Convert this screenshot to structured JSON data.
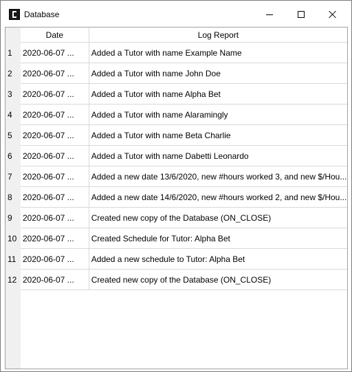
{
  "window": {
    "title": "Database",
    "icon": "app-logo-icon"
  },
  "table": {
    "headers": {
      "date": "Date",
      "log": "Log Report"
    },
    "rows": [
      {
        "num": "1",
        "date": "2020-06-07 ...",
        "log": "Added a Tutor with name Example Name"
      },
      {
        "num": "2",
        "date": "2020-06-07 ...",
        "log": "Added a Tutor with name John Doe"
      },
      {
        "num": "3",
        "date": "2020-06-07 ...",
        "log": "Added a Tutor with name Alpha Bet"
      },
      {
        "num": "4",
        "date": "2020-06-07 ...",
        "log": "Added a Tutor with name Alaramingly"
      },
      {
        "num": "5",
        "date": "2020-06-07 ...",
        "log": "Added a Tutor with name Beta Charlie"
      },
      {
        "num": "6",
        "date": "2020-06-07 ...",
        "log": "Added a Tutor with name Dabetti Leonardo"
      },
      {
        "num": "7",
        "date": "2020-06-07 ...",
        "log": "Added a new date 13/6/2020, new #hours worked 3, and new $/Hou..."
      },
      {
        "num": "8",
        "date": "2020-06-07 ...",
        "log": "Added a new date 14/6/2020, new #hours worked 2, and new $/Hou..."
      },
      {
        "num": "9",
        "date": "2020-06-07 ...",
        "log": "Created new copy of the Database (ON_CLOSE)"
      },
      {
        "num": "10",
        "date": "2020-06-07 ...",
        "log": "Created Schedule for Tutor: Alpha Bet"
      },
      {
        "num": "11",
        "date": "2020-06-07 ...",
        "log": "Added a new schedule to Tutor: Alpha Bet"
      },
      {
        "num": "12",
        "date": "2020-06-07 ...",
        "log": "Created new copy of the Database (ON_CLOSE)"
      }
    ]
  }
}
